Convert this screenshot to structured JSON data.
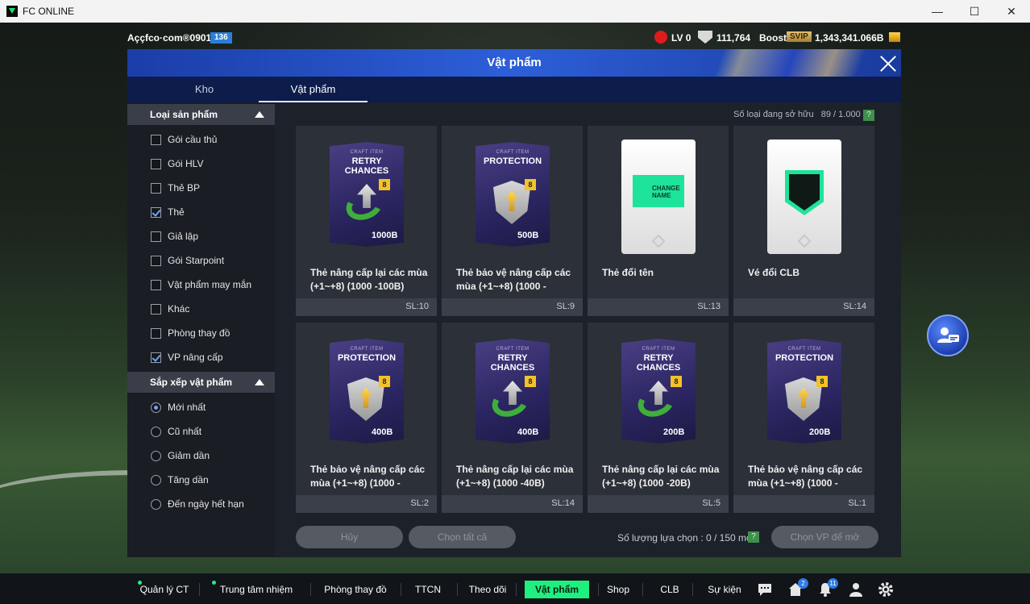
{
  "window": {
    "title": "FC ONLINE",
    "minimize": "—",
    "maximize": "☐",
    "close": "✕"
  },
  "status": {
    "account": "Aççfco·com®0901q",
    "account_badge": "136",
    "level": "LV 0",
    "crest_value": "111,764",
    "boost_label": "Boost",
    "svip_label": "SVIP",
    "bp_value": "1,343,341.066B"
  },
  "panel": {
    "title": "Vật phẩm",
    "tabs": [
      "Kho",
      "Vật phẩm"
    ],
    "active_tab": "Vật phẩm"
  },
  "sidebar": {
    "category_header": "Loại sản phẩm",
    "categories": [
      {
        "label": "Gói cầu thủ",
        "checked": false
      },
      {
        "label": "Gói HLV",
        "checked": false
      },
      {
        "label": "Thẻ BP",
        "checked": false
      },
      {
        "label": "Thẻ",
        "checked": true
      },
      {
        "label": "Giả lập",
        "checked": false
      },
      {
        "label": "Gói Starpoint",
        "checked": false
      },
      {
        "label": "Vật phẩm may mắn",
        "checked": false
      },
      {
        "label": "Khác",
        "checked": false
      },
      {
        "label": "Phòng thay đồ",
        "checked": false
      },
      {
        "label": "VP nâng cấp",
        "checked": true
      }
    ],
    "sort_header": "Sắp xếp vật phẩm",
    "sort_options": [
      {
        "label": "Mới nhất",
        "selected": true
      },
      {
        "label": "Cũ nhất",
        "selected": false
      },
      {
        "label": "Giảm dần",
        "selected": false
      },
      {
        "label": "Tăng dần",
        "selected": false
      },
      {
        "label": "Đến ngày hết hạn",
        "selected": false
      }
    ]
  },
  "content": {
    "owned_label": "Số loại đang sở hữu",
    "owned_value": "89 / 1.000 cái",
    "help": "?",
    "items": [
      {
        "name": "Thẻ nâng cấp lại các mùa (+1~+8) (1000 -100B)",
        "qty": "SL:10",
        "kind": "retry",
        "pack_title": "RETRY CHANCES",
        "craft": "CRAFT ITEM",
        "badge": "8",
        "price": "1000B"
      },
      {
        "name": "Thẻ bảo vệ nâng cấp các mùa (+1~+8) (1000 -",
        "qty": "SL:9",
        "kind": "protection",
        "pack_title": "PROTECTION",
        "craft": "CRAFT ITEM",
        "badge": "8",
        "price": "500B"
      },
      {
        "name": "Thẻ đổi tên",
        "qty": "SL:13",
        "kind": "rename",
        "ticket_text": "CHANGE NAME"
      },
      {
        "name": "Vé đổi CLB",
        "qty": "SL:14",
        "kind": "club"
      },
      {
        "name": "Thẻ bảo vệ nâng cấp các mùa (+1~+8) (1000 -",
        "qty": "SL:2",
        "kind": "protection",
        "pack_title": "PROTECTION",
        "craft": "CRAFT ITEM",
        "badge": "8",
        "price": "400B"
      },
      {
        "name": "Thẻ nâng cấp lại các mùa (+1~+8) (1000 -40B)",
        "qty": "SL:14",
        "kind": "retry",
        "pack_title": "RETRY CHANCES",
        "craft": "CRAFT ITEM",
        "badge": "8",
        "price": "400B"
      },
      {
        "name": "Thẻ nâng cấp lại các mùa (+1~+8) (1000 -20B)",
        "qty": "SL:5",
        "kind": "retry",
        "pack_title": "RETRY CHANCES",
        "craft": "CRAFT ITEM",
        "badge": "8",
        "price": "200B"
      },
      {
        "name": "Thẻ bảo vệ nâng cấp các mùa (+1~+8) (1000 -",
        "qty": "SL:1",
        "kind": "protection",
        "pack_title": "PROTECTION",
        "craft": "CRAFT ITEM",
        "badge": "8",
        "price": "200B"
      }
    ],
    "cancel_button": "Hủy",
    "select_all_button": "Chọn tất cả",
    "select_count_label": "Số lượng lựa chọn : 0 / 150 món",
    "open_button": "Chọn VP để mở"
  },
  "bottom_nav": {
    "items": [
      "Quản lý CT",
      "Trung tâm nhiệm vụ",
      "Phòng thay đồ",
      "TTCN",
      "Theo dõi",
      "Vật phẩm",
      "Shop",
      "CLB",
      "Sự kiện"
    ],
    "active": "Vật phẩm",
    "home_badge": "2",
    "bell_badge": "11"
  },
  "colors": {
    "accent_green": "#1ef07f",
    "header_blue": "#2d5fd8",
    "check_blue": "#6fa4ff"
  }
}
